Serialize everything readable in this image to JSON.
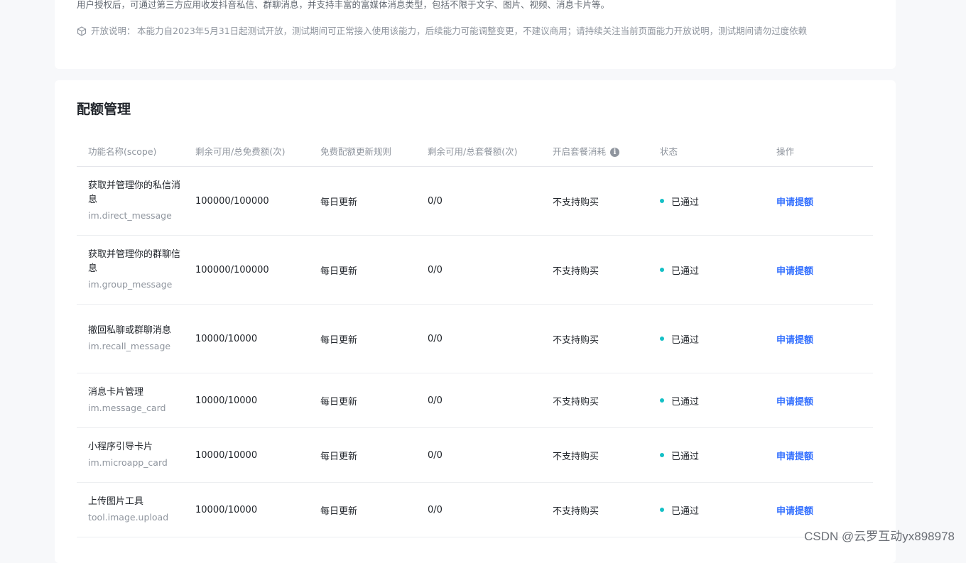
{
  "intro": {
    "text": "用户授权后，可通过第三方应用收发抖音私信、群聊消息，并支持丰富的富媒体消息类型，包括不限于文字、图片、视频、消息卡片等。",
    "notice_label": "开放说明：",
    "notice_text": "本能力自2023年5月31日起测试开放，测试期间可正常接入使用该能力，后续能力可能调整变更，不建议商用；请持续关注当前页面能力开放说明，测试期间请勿过度依赖"
  },
  "quota": {
    "title": "配额管理",
    "columns": {
      "name": "功能名称(scope)",
      "free_quota": "剩余可用/总免费额(次)",
      "refresh_rule": "免费配额更新规则",
      "package_quota": "剩余可用/总套餐额(次)",
      "package_consume": "开启套餐消耗",
      "status": "状态",
      "action": "操作"
    },
    "rows": [
      {
        "name": "获取并管理你的私信消息",
        "scope": "im.direct_message",
        "free_quota": "100000/100000",
        "refresh_rule": "每日更新",
        "package_quota": "0/0",
        "package_consume": "不支持购买",
        "status": "已通过",
        "action": "申请提额"
      },
      {
        "name": "获取并管理你的群聊信息",
        "scope": "im.group_message",
        "free_quota": "100000/100000",
        "refresh_rule": "每日更新",
        "package_quota": "0/0",
        "package_consume": "不支持购买",
        "status": "已通过",
        "action": "申请提额"
      },
      {
        "name": "撤回私聊或群聊消息",
        "scope": "im.recall_message",
        "free_quota": "10000/10000",
        "refresh_rule": "每日更新",
        "package_quota": "0/0",
        "package_consume": "不支持购买",
        "status": "已通过",
        "action": "申请提额"
      },
      {
        "name": "消息卡片管理",
        "scope": "im.message_card",
        "free_quota": "10000/10000",
        "refresh_rule": "每日更新",
        "package_quota": "0/0",
        "package_consume": "不支持购买",
        "status": "已通过",
        "action": "申请提额"
      },
      {
        "name": "小程序引导卡片",
        "scope": "im.microapp_card",
        "free_quota": "10000/10000",
        "refresh_rule": "每日更新",
        "package_quota": "0/0",
        "package_consume": "不支持购买",
        "status": "已通过",
        "action": "申请提额"
      },
      {
        "name": "上传图片工具",
        "scope": "tool.image.upload",
        "free_quota": "10000/10000",
        "refresh_rule": "每日更新",
        "package_quota": "0/0",
        "package_consume": "不支持购买",
        "status": "已通过",
        "action": "申请提额"
      }
    ]
  },
  "watermark": "CSDN @云罗互动yx898978",
  "colors": {
    "link": "#3370ff",
    "status_dot": "#14c0c6",
    "background": "#f7f8fa"
  },
  "icons": {
    "notice": "cube-icon",
    "info": "info-icon"
  }
}
